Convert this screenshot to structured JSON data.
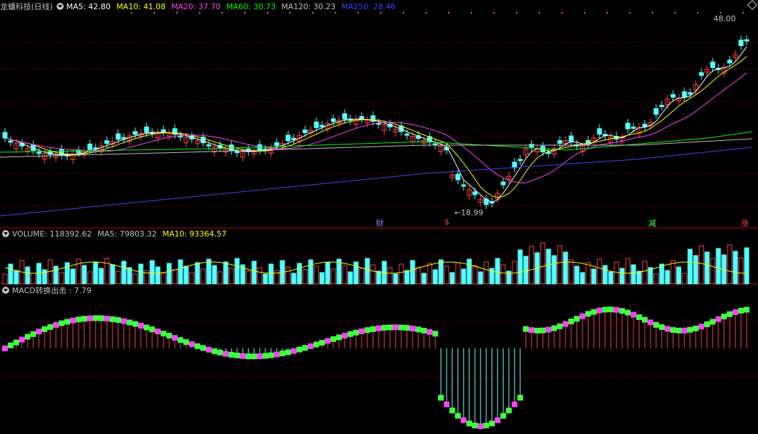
{
  "header": {
    "title": "龙蟠科技(日线)",
    "ma5": "MA5: 42.80",
    "ma10": "MA10: 41.08",
    "ma20": "MA20: 37.70",
    "ma60": "MA60: 30.73",
    "ma120": "MA120: 30.23",
    "ma250": "MA250: 28.46"
  },
  "price": {
    "top_label": "48.00",
    "low_label": "←18.99",
    "events": [
      "财",
      "$",
      "减",
      "涨"
    ]
  },
  "volume": {
    "label": "VOLUME: 118392.62",
    "ma5": "MA5: 79803.32",
    "ma10": "MA10: 93364.57"
  },
  "macd": {
    "label": "MACD转换出击 : 7.79"
  },
  "colors": {
    "ma5": "#ffffff",
    "ma10": "#ffff00",
    "ma20": "#ff40ff",
    "ma60": "#00ff00",
    "ma120": "#c0c0c0",
    "ma250": "#4040ff",
    "up": "#ff4040",
    "down": "#54ffff",
    "macd_up": "#ff40ff",
    "macd_down": "#40ff40"
  },
  "icons": [
    "dropdown-icon",
    "corner-diamond-icon"
  ]
}
